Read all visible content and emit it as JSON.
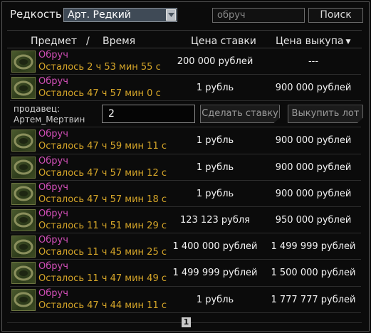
{
  "filter": {
    "rarity_label": "Редкость",
    "rarity_value": "Арт. Редкий",
    "search_value": "обруч",
    "search_button": "Поиск"
  },
  "header": {
    "item": "Предмет",
    "separator": "/",
    "time": "Время",
    "bid": "Цена ставки",
    "buyout": "Цена выкупа"
  },
  "rows": [
    {
      "name": "Обруч",
      "time": "Осталось 2 ч 53 мин 55 с",
      "bid": "200 000 рублей",
      "buyout": "---"
    },
    {
      "name": "Обруч",
      "time": "Осталось 47 ч 57 мин 0 с",
      "bid": "1 рубль",
      "buyout": "900 000 рублей"
    },
    {
      "name": "Обруч",
      "time": "Осталось 47 ч 59 мин 11 с",
      "bid": "1 рубль",
      "buyout": "900 000 рублей"
    },
    {
      "name": "Обруч",
      "time": "Осталось 47 ч 57 мин 12 с",
      "bid": "1 рубль",
      "buyout": "900 000 рублей"
    },
    {
      "name": "Обруч",
      "time": "Осталось 47 ч 57 мин 18 с",
      "bid": "1 рубль",
      "buyout": "900 000 рублей"
    },
    {
      "name": "Обруч",
      "time": "Осталось 11 ч 51 мин 29 с",
      "bid": "123 123 рубля",
      "buyout": "950 000 рублей"
    },
    {
      "name": "Обруч",
      "time": "Осталось 11 ч 45 мин 25 с",
      "bid": "1 400 000 рублей",
      "buyout": "1 499 999 рублей"
    },
    {
      "name": "Обруч",
      "time": "Осталось 11 ч 47 мин 49 с",
      "bid": "1 499 999 рублей",
      "buyout": "1 500 000 рублей"
    },
    {
      "name": "Обруч",
      "time": "Осталось 47 ч 44 мин 11 с",
      "bid": "1 рубль",
      "buyout": "1 777 777 рублей"
    }
  ],
  "expanded": {
    "seller_label": "продавец:",
    "seller_name": "Артем_Мертвин",
    "bid_value": "2",
    "bid_button": "Сделать ставку",
    "buyout_button": "Выкупить лот"
  },
  "pagination": {
    "current_page": "1"
  },
  "icons": {
    "item_thumb": "hoop-artifact-icon",
    "dropdown": "chevron-down-icon",
    "sort": "sort-desc-icon"
  },
  "colors": {
    "item_name": "#d24fb8",
    "time_left": "#d6a629",
    "select_bg": "#3f4a56"
  }
}
